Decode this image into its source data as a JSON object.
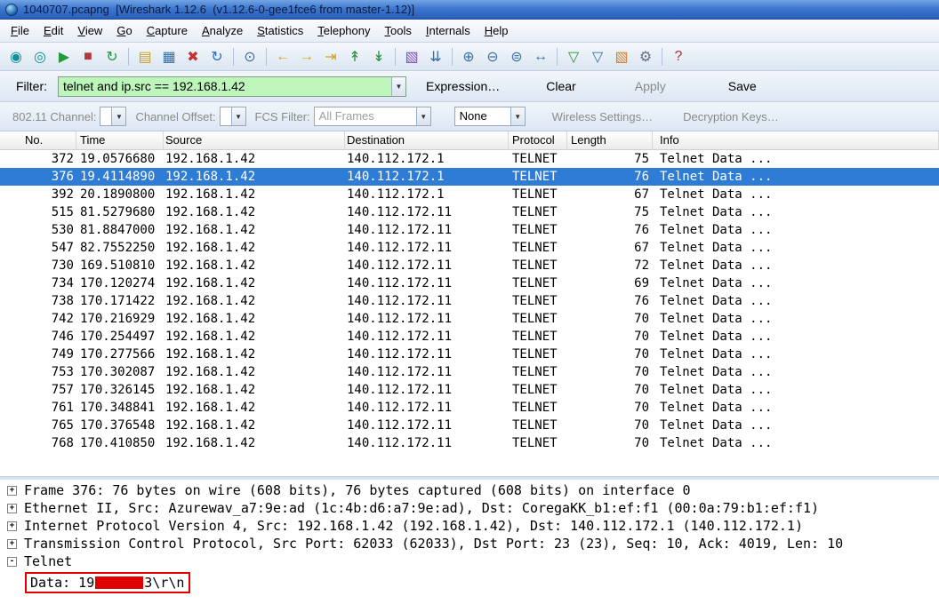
{
  "window": {
    "title": "1040707.pcapng  [Wireshark 1.12.6  (v1.12.6-0-gee1fce6 from master-1.12)]"
  },
  "menu": {
    "items": [
      "File",
      "Edit",
      "View",
      "Go",
      "Capture",
      "Analyze",
      "Statistics",
      "Telephony",
      "Tools",
      "Internals",
      "Help"
    ]
  },
  "toolbar": {
    "icons": [
      {
        "name": "list-interfaces-icon",
        "glyph": "◉",
        "color": "#0f8f9a"
      },
      {
        "name": "capture-options-icon",
        "glyph": "◎",
        "color": "#0f8f9a"
      },
      {
        "name": "start-capture-icon",
        "glyph": "▶",
        "color": "#259a3c"
      },
      {
        "name": "stop-capture-icon",
        "glyph": "■",
        "color": "#b23a3a"
      },
      {
        "name": "restart-capture-icon",
        "glyph": "↻",
        "color": "#259a3c"
      },
      {
        "sep": true
      },
      {
        "name": "open-file-icon",
        "glyph": "▤",
        "color": "#c9a227"
      },
      {
        "name": "save-file-icon",
        "glyph": "▦",
        "color": "#3a6ea5"
      },
      {
        "name": "close-file-icon",
        "glyph": "✖",
        "color": "#c03333"
      },
      {
        "name": "reload-file-icon",
        "glyph": "↻",
        "color": "#2f6fc0"
      },
      {
        "sep": true
      },
      {
        "name": "find-packet-icon",
        "glyph": "⊙",
        "color": "#3a6ea5"
      },
      {
        "sep": true
      },
      {
        "name": "go-back-icon",
        "glyph": "←",
        "color": "#d8a01d"
      },
      {
        "name": "go-forward-icon",
        "glyph": "→",
        "color": "#d8a01d"
      },
      {
        "name": "go-to-packet-icon",
        "glyph": "⇥",
        "color": "#d8a01d"
      },
      {
        "name": "go-top-icon",
        "glyph": "↟",
        "color": "#2f8f3a"
      },
      {
        "name": "go-bottom-icon",
        "glyph": "↡",
        "color": "#2f8f3a"
      },
      {
        "sep": true
      },
      {
        "name": "colorize-icon",
        "glyph": "▧",
        "color": "#7a4fb5"
      },
      {
        "name": "autoscroll-icon",
        "glyph": "⇊",
        "color": "#3a6ea5"
      },
      {
        "sep": true
      },
      {
        "name": "zoom-in-icon",
        "glyph": "⊕",
        "color": "#3a6ea5"
      },
      {
        "name": "zoom-out-icon",
        "glyph": "⊖",
        "color": "#3a6ea5"
      },
      {
        "name": "zoom-100-icon",
        "glyph": "⊜",
        "color": "#3a6ea5"
      },
      {
        "name": "resize-columns-icon",
        "glyph": "↔",
        "color": "#3a6ea5"
      },
      {
        "sep": true
      },
      {
        "name": "capture-filters-icon",
        "glyph": "▽",
        "color": "#2f8f3a"
      },
      {
        "name": "display-filters-icon",
        "glyph": "▽",
        "color": "#3a6ea5"
      },
      {
        "name": "coloring-rules-icon",
        "glyph": "▧",
        "color": "#cf7f2f"
      },
      {
        "name": "preferences-icon",
        "glyph": "⚙",
        "color": "#667180"
      },
      {
        "sep": true
      },
      {
        "name": "help-icon",
        "glyph": "?",
        "color": "#b03030"
      }
    ]
  },
  "filter_bar": {
    "label": "Filter:",
    "value": "telnet and ip.src == 192.168.1.42",
    "expression": "Expression…",
    "clear": "Clear",
    "apply": "Apply",
    "save": "Save"
  },
  "wireless_bar": {
    "channel_label": "802.11 Channel:",
    "offset_label": "Channel Offset:",
    "fcs_label": "FCS Filter:",
    "fcs_value": "All Frames",
    "none_value": "None",
    "wireless_settings": "Wireless Settings…",
    "decryption_keys": "Decryption Keys…"
  },
  "packet_list": {
    "columns": [
      "No.",
      "Time",
      "Source",
      "Destination",
      "Protocol",
      "Length",
      "Info"
    ],
    "selected_index": 1,
    "rows": [
      [
        "372",
        "19.0576680",
        "192.168.1.42",
        "140.112.172.1",
        "TELNET",
        "75",
        "Telnet Data ..."
      ],
      [
        "376",
        "19.4114890",
        "192.168.1.42",
        "140.112.172.1",
        "TELNET",
        "76",
        "Telnet Data ..."
      ],
      [
        "392",
        "20.1890800",
        "192.168.1.42",
        "140.112.172.1",
        "TELNET",
        "67",
        "Telnet Data ..."
      ],
      [
        "515",
        "81.5279680",
        "192.168.1.42",
        "140.112.172.11",
        "TELNET",
        "75",
        "Telnet Data ..."
      ],
      [
        "530",
        "81.8847000",
        "192.168.1.42",
        "140.112.172.11",
        "TELNET",
        "76",
        "Telnet Data ..."
      ],
      [
        "547",
        "82.7552250",
        "192.168.1.42",
        "140.112.172.11",
        "TELNET",
        "67",
        "Telnet Data ..."
      ],
      [
        "730",
        "169.510810",
        "192.168.1.42",
        "140.112.172.11",
        "TELNET",
        "72",
        "Telnet Data ..."
      ],
      [
        "734",
        "170.120274",
        "192.168.1.42",
        "140.112.172.11",
        "TELNET",
        "69",
        "Telnet Data ..."
      ],
      [
        "738",
        "170.171422",
        "192.168.1.42",
        "140.112.172.11",
        "TELNET",
        "76",
        "Telnet Data ..."
      ],
      [
        "742",
        "170.216929",
        "192.168.1.42",
        "140.112.172.11",
        "TELNET",
        "70",
        "Telnet Data ..."
      ],
      [
        "746",
        "170.254497",
        "192.168.1.42",
        "140.112.172.11",
        "TELNET",
        "70",
        "Telnet Data ..."
      ],
      [
        "749",
        "170.277566",
        "192.168.1.42",
        "140.112.172.11",
        "TELNET",
        "70",
        "Telnet Data ..."
      ],
      [
        "753",
        "170.302087",
        "192.168.1.42",
        "140.112.172.11",
        "TELNET",
        "70",
        "Telnet Data ..."
      ],
      [
        "757",
        "170.326145",
        "192.168.1.42",
        "140.112.172.11",
        "TELNET",
        "70",
        "Telnet Data ..."
      ],
      [
        "761",
        "170.348841",
        "192.168.1.42",
        "140.112.172.11",
        "TELNET",
        "70",
        "Telnet Data ..."
      ],
      [
        "765",
        "170.376548",
        "192.168.1.42",
        "140.112.172.11",
        "TELNET",
        "70",
        "Telnet Data ..."
      ],
      [
        "768",
        "170.410850",
        "192.168.1.42",
        "140.112.172.11",
        "TELNET",
        "70",
        "Telnet Data ..."
      ]
    ]
  },
  "details": {
    "lines": [
      {
        "exp": "+",
        "text": "Frame 376: 76 bytes on wire (608 bits), 76 bytes captured (608 bits) on interface 0"
      },
      {
        "exp": "+",
        "text": "Ethernet II, Src: Azurewav_a7:9e:ad (1c:4b:d6:a7:9e:ad), Dst: CoregaKK_b1:ef:f1 (00:0a:79:b1:ef:f1)"
      },
      {
        "exp": "+",
        "text": "Internet Protocol Version 4, Src: 192.168.1.42 (192.168.1.42), Dst: 140.112.172.1 (140.112.172.1)"
      },
      {
        "exp": "+",
        "text": "Transmission Control Protocol, Src Port: 62033 (62033), Dst Port: 23 (23), Seq: 10, Ack: 4019, Len: 10"
      },
      {
        "exp": "-",
        "text": "Telnet"
      }
    ],
    "data_line": {
      "prefix": "Data: 19",
      "suffix": "3\\r\\n"
    }
  },
  "colors": {
    "selected_row": "#2e7cd6",
    "filter_input_bg": "#bdf5bb",
    "annotation_red": "#e00000",
    "titlebar_blue": "#3d77cf"
  }
}
